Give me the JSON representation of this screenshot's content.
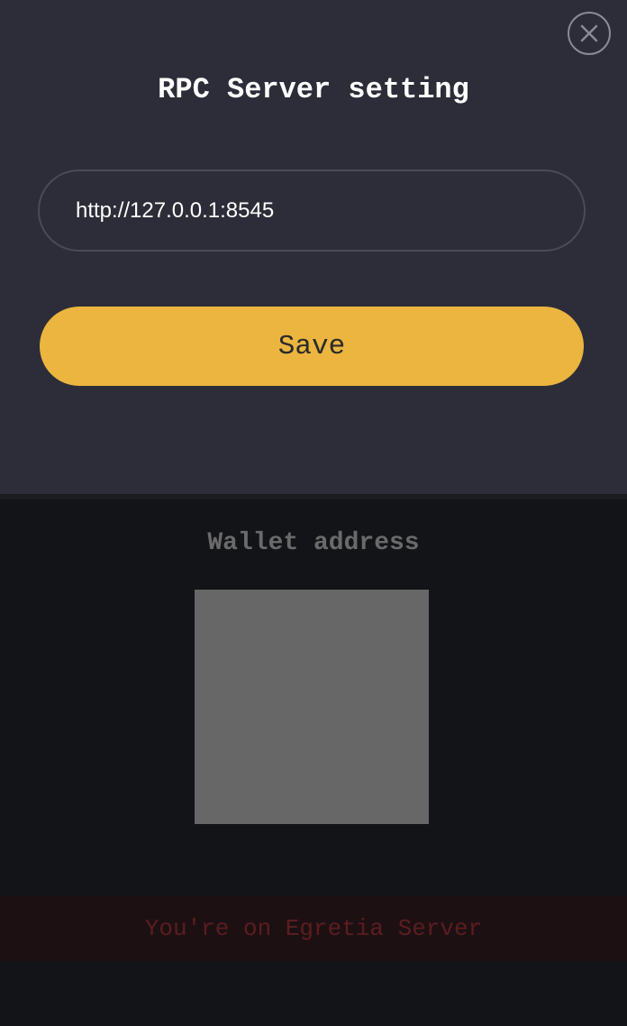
{
  "modal": {
    "title": "RPC Server setting",
    "rpc_input": {
      "value": "http://127.0.0.1:8545",
      "placeholder": ""
    },
    "save_label": "Save",
    "close_icon": "close-icon"
  },
  "background": {
    "wallet_title": "Wallet address",
    "qr_code_icon": "qr-code-placeholder",
    "server_banner": "You're on Egretia Server"
  },
  "colors": {
    "modal_background": "#2c2d38",
    "page_background": "#131417",
    "accent": "#ebb53f",
    "banner_background": "#1d1013",
    "banner_text": "#5b1d1f"
  }
}
